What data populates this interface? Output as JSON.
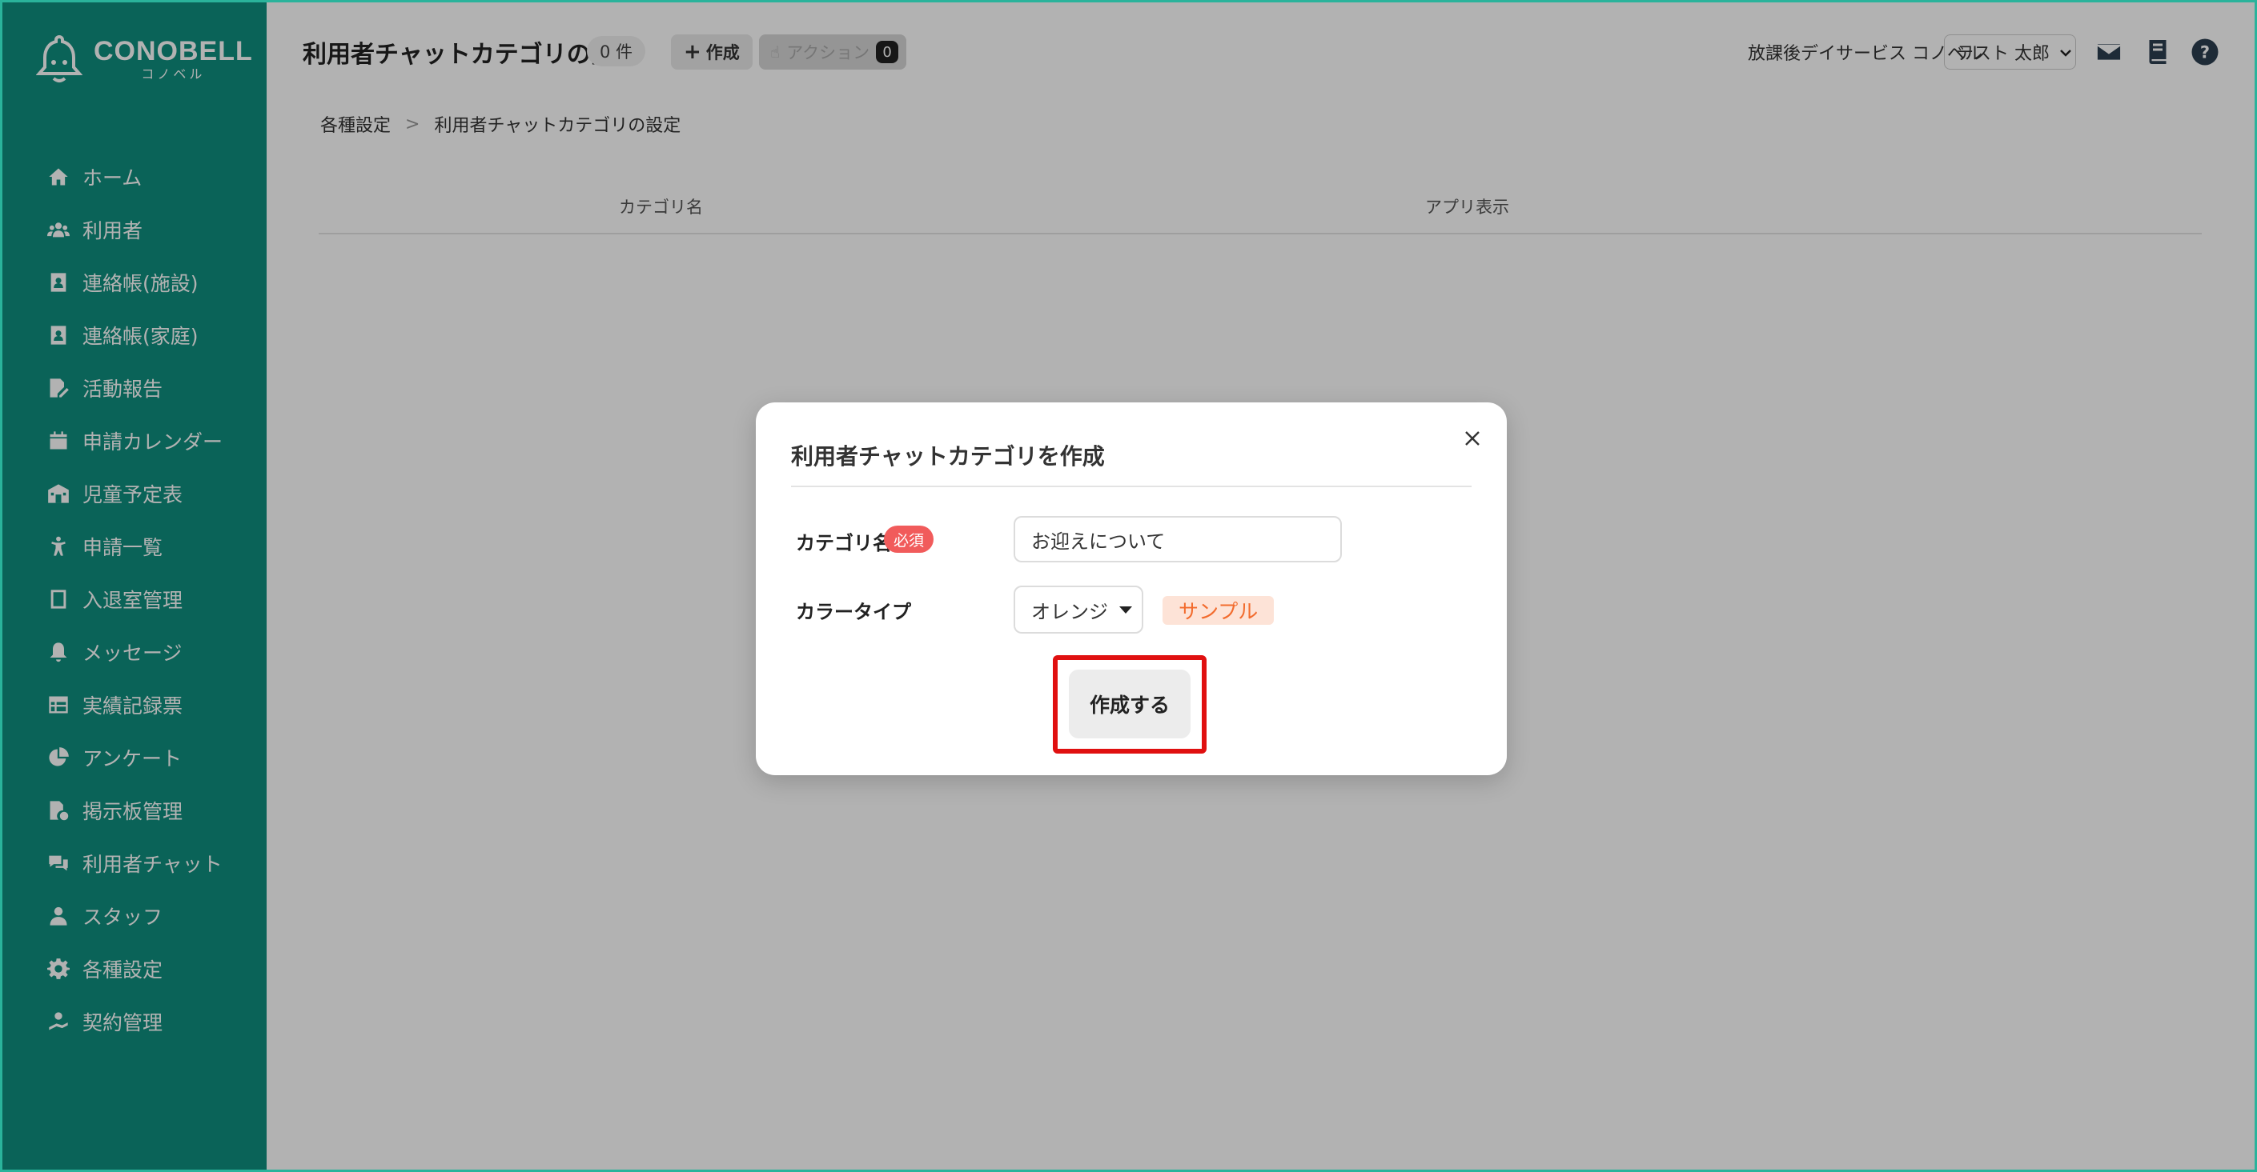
{
  "sidebar": {
    "logo_text": "CONOBELL",
    "logo_sub": "コノベル",
    "items": [
      {
        "label": "ホーム",
        "icon": "home-icon"
      },
      {
        "label": "利用者",
        "icon": "users-icon"
      },
      {
        "label": "連絡帳(施設)",
        "icon": "contact-book-icon"
      },
      {
        "label": "連絡帳(家庭)",
        "icon": "contact-book-icon"
      },
      {
        "label": "活動報告",
        "icon": "report-edit-icon"
      },
      {
        "label": "申請カレンダー",
        "icon": "calendar-icon"
      },
      {
        "label": "児童予定表",
        "icon": "schedule-icon"
      },
      {
        "label": "申請一覧",
        "icon": "child-icon"
      },
      {
        "label": "入退室管理",
        "icon": "tablet-icon"
      },
      {
        "label": "メッセージ",
        "icon": "bell-icon"
      },
      {
        "label": "実績記録票",
        "icon": "table-icon"
      },
      {
        "label": "アンケート",
        "icon": "pie-chart-icon"
      },
      {
        "label": "掲示板管理",
        "icon": "board-file-icon"
      },
      {
        "label": "利用者チャット",
        "icon": "chat-icon"
      },
      {
        "label": "スタッフ",
        "icon": "staff-icon"
      },
      {
        "label": "各種設定",
        "icon": "gear-icon"
      },
      {
        "label": "契約管理",
        "icon": "contract-icon"
      }
    ]
  },
  "header": {
    "title": "利用者チャットカテゴリの設定",
    "count": "0 件",
    "create_label": "作成",
    "action_label": "アクション",
    "action_count": "0",
    "facility": "放課後デイサービス コノベル",
    "user_name": "テスト 太郎"
  },
  "breadcrumb": {
    "parent": "各種設定",
    "separator": ">",
    "current": "利用者チャットカテゴリの設定"
  },
  "table": {
    "columns": [
      "カテゴリ名",
      "アプリ表示"
    ]
  },
  "modal": {
    "title": "利用者チャットカテゴリを作成",
    "category_label": "カテゴリ名",
    "required_badge": "必須",
    "category_value": "お迎えについて",
    "color_label": "カラータイプ",
    "color_value": "オレンジ",
    "sample_label": "サンプル",
    "submit_label": "作成する"
  },
  "colors": {
    "sidebar": "#0f8f7e",
    "required": "#f15b5b",
    "sample_bg": "#fde3d7",
    "sample_text": "#f26b2d",
    "highlight": "#e01010"
  }
}
